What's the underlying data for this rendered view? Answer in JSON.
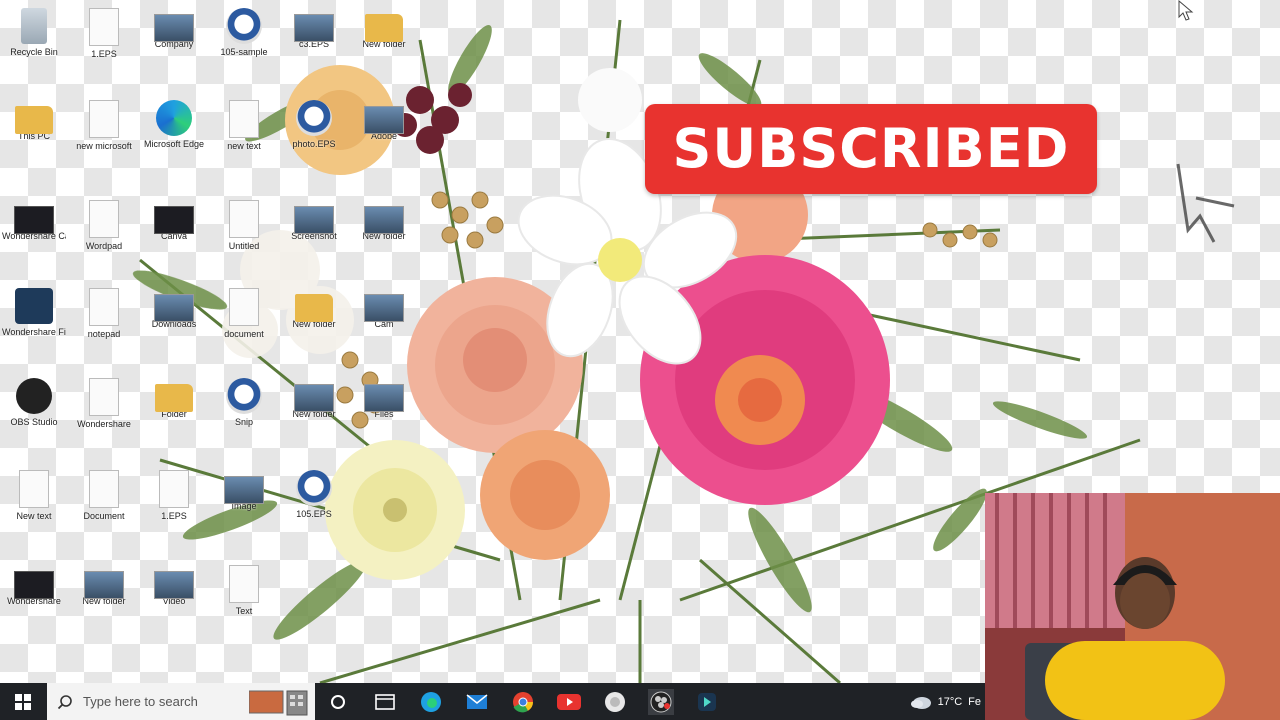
{
  "banner": {
    "subscribed_label": "SUBSCRIBED"
  },
  "desktop_icons": [
    {
      "label": "Recycle Bin",
      "icon": "recycle-bin-icon"
    },
    {
      "label": "1.EPS",
      "icon": "file-icon"
    },
    {
      "label": "Company",
      "icon": "image-icon"
    },
    {
      "label": "105-sample",
      "icon": "photo-icon"
    },
    {
      "label": "c3.EPS",
      "icon": "image-icon"
    },
    {
      "label": "New folder",
      "icon": "folder-icon"
    },
    {
      "label": "This PC",
      "icon": "music-folder-icon"
    },
    {
      "label": "new microsoft",
      "icon": "document-icon"
    },
    {
      "label": "Microsoft Edge",
      "icon": "edge-icon"
    },
    {
      "label": "new text",
      "icon": "document-icon"
    },
    {
      "label": "photo.EPS",
      "icon": "photo-icon"
    },
    {
      "label": "Adobe",
      "icon": "image-icon"
    },
    {
      "label": "Wondershare Capture",
      "icon": "app-icon"
    },
    {
      "label": "Wordpad",
      "icon": "document-icon"
    },
    {
      "label": "Canva",
      "icon": "app-icon"
    },
    {
      "label": "Untitled",
      "icon": "document-icon"
    },
    {
      "label": "Screenshot",
      "icon": "image-icon"
    },
    {
      "label": "New folder",
      "icon": "image-icon"
    },
    {
      "label": "Wondershare Filmora X",
      "icon": "filmora-icon"
    },
    {
      "label": "notepad",
      "icon": "document-icon"
    },
    {
      "label": "Downloads",
      "icon": "image-icon"
    },
    {
      "label": "document",
      "icon": "document-icon"
    },
    {
      "label": "New folder",
      "icon": "folder-icon"
    },
    {
      "label": "Cam",
      "icon": "image-icon"
    },
    {
      "label": "OBS Studio",
      "icon": "obs-icon"
    },
    {
      "label": "Wondershare",
      "icon": "document-icon"
    },
    {
      "label": "Folder",
      "icon": "folder-icon"
    },
    {
      "label": "Snip",
      "icon": "snip-icon"
    },
    {
      "label": "New folder",
      "icon": "image-icon"
    },
    {
      "label": "Files",
      "icon": "image-icon"
    },
    {
      "label": "New text",
      "icon": "document-icon"
    },
    {
      "label": "Document",
      "icon": "document-icon"
    },
    {
      "label": "1.EPS",
      "icon": "document-icon"
    },
    {
      "label": "Image",
      "icon": "image-icon"
    },
    {
      "label": "105.EPS",
      "icon": "photo-icon"
    },
    {
      "label": "Wondershare",
      "icon": "app-icon"
    },
    {
      "label": "New folder",
      "icon": "image-icon"
    },
    {
      "label": "Video",
      "icon": "image-icon"
    },
    {
      "label": "Text",
      "icon": "document-icon"
    }
  ],
  "taskbar": {
    "search_placeholder": "Type here to search",
    "weather": "17°C",
    "weather_more": "Fe",
    "apps": [
      "task-view-icon",
      "edge-icon",
      "mail-icon",
      "chrome-icon",
      "youtube-icon",
      "generic-app-icon",
      "obs-icon",
      "filmora-icon"
    ]
  },
  "colors": {
    "badge_red": "#e8332f",
    "taskbar": "#1f2226"
  }
}
